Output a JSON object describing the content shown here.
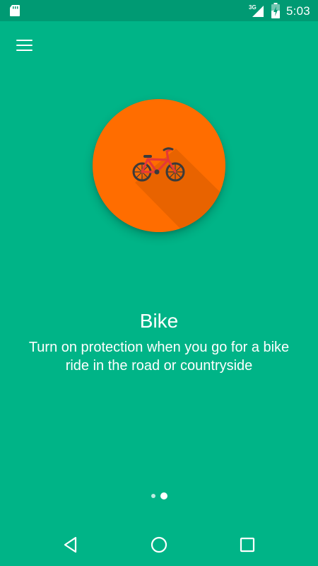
{
  "status_bar": {
    "time": "5:03",
    "network": "3G",
    "icons": [
      "sd-card-icon",
      "signal-icon",
      "battery-charging-icon"
    ]
  },
  "toolbar": {
    "menu_icon": "hamburger-menu-icon"
  },
  "onboarding": {
    "illustration_icon": "bike-icon",
    "colors": {
      "background": "#00b487",
      "circle": "#ff6d00",
      "bike": "#e53935"
    },
    "title": "Bike",
    "description": "Turn on protection when you go for a bike ride in the road or countryside",
    "page_indicator": {
      "total": 2,
      "current": 2
    }
  },
  "navigation_bar": {
    "buttons": [
      "back-icon",
      "home-icon",
      "recents-icon"
    ]
  }
}
